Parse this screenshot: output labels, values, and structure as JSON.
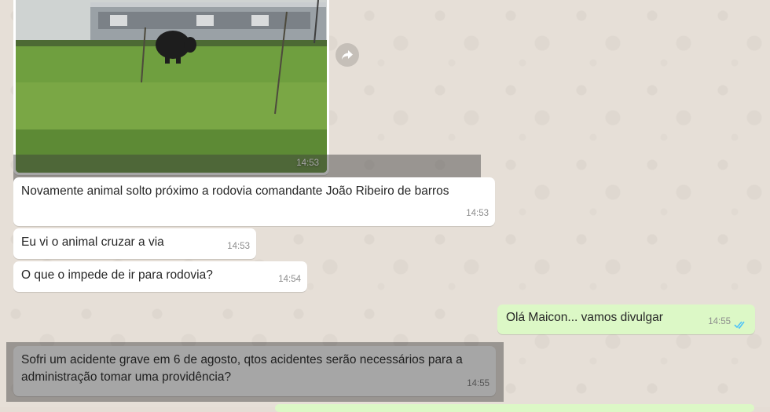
{
  "messages": {
    "photo": {
      "time": "14:53"
    },
    "m1": {
      "text": "Novamente animal solto próximo a rodovia comandante João Ribeiro de barros",
      "time": "14:53"
    },
    "m2": {
      "text": "Eu vi o animal cruzar a via",
      "time": "14:53"
    },
    "m3": {
      "text": "O que o impede de ir para rodovia?",
      "time": "14:54"
    },
    "m4": {
      "text": "Olá Maicon... vamos divulgar",
      "time": "14:55",
      "status": "read-double-check-icon"
    },
    "m5": {
      "line1": "Sofri um acidente grave em 6 de agosto, qtos acidentes serão necessários para a",
      "line2": "administração tomar uma providência?",
      "time": "14:55"
    }
  },
  "colors": {
    "incoming": "#ffffff",
    "outgoing": "#dcf8c6",
    "read_check": "#4fc3f7",
    "highlight": "rgba(60,60,60,0.45)"
  },
  "icons": [
    "forward-icon",
    "read-double-check-icon"
  ]
}
